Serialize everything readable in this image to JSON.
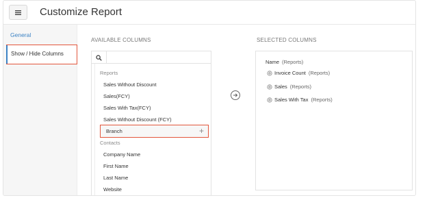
{
  "header": {
    "title": "Customize Report"
  },
  "sidebar": {
    "items": [
      {
        "label": "General"
      },
      {
        "label": "Show / Hide Columns"
      }
    ]
  },
  "available": {
    "heading": "AVAILABLE COLUMNS",
    "search_value": "",
    "groups": [
      {
        "label": "Reports",
        "items": [
          "Sales Without Discount",
          "Sales(FCY)",
          "Sales With Tax(FCY)",
          "Sales Without Discount (FCY)",
          "Branch"
        ]
      },
      {
        "label": "Contacts",
        "items": [
          "Company Name",
          "First Name",
          "Last Name",
          "Website"
        ]
      }
    ]
  },
  "selected": {
    "heading": "SELECTED COLUMNS",
    "items": [
      {
        "name": "Name",
        "group": "(Reports)"
      },
      {
        "name": "Invoice Count",
        "group": "(Reports)"
      },
      {
        "name": "Sales",
        "group": "(Reports)"
      },
      {
        "name": "Sales With Tax",
        "group": "(Reports)"
      }
    ]
  },
  "colors": {
    "accent": "#3b82c4",
    "highlight_border": "#e2553b"
  },
  "icons": {
    "menu": "hamburger-icon",
    "search": "search-icon",
    "move": "arrow-right-circle-icon",
    "add": "plus-icon",
    "drag": "gear-icon"
  }
}
